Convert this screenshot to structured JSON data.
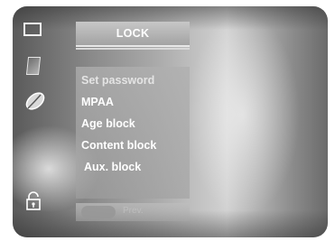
{
  "menu": {
    "title": "LOCK",
    "items": [
      {
        "label": "Set password"
      },
      {
        "label": "MPAA"
      },
      {
        "label": "Age block"
      },
      {
        "label": "Content block"
      },
      {
        "label": "Aux. block"
      }
    ]
  },
  "footer": {
    "prev_label": "Prev."
  },
  "sidebar_icons": [
    "screen-icon",
    "document-icon",
    "leaf-icon",
    "lock-icon"
  ],
  "colors": {
    "text": "#ffffff",
    "panel": "#a8a8a8",
    "background_dark": "#5a5a5a",
    "background_light": "#d2d2d2"
  }
}
